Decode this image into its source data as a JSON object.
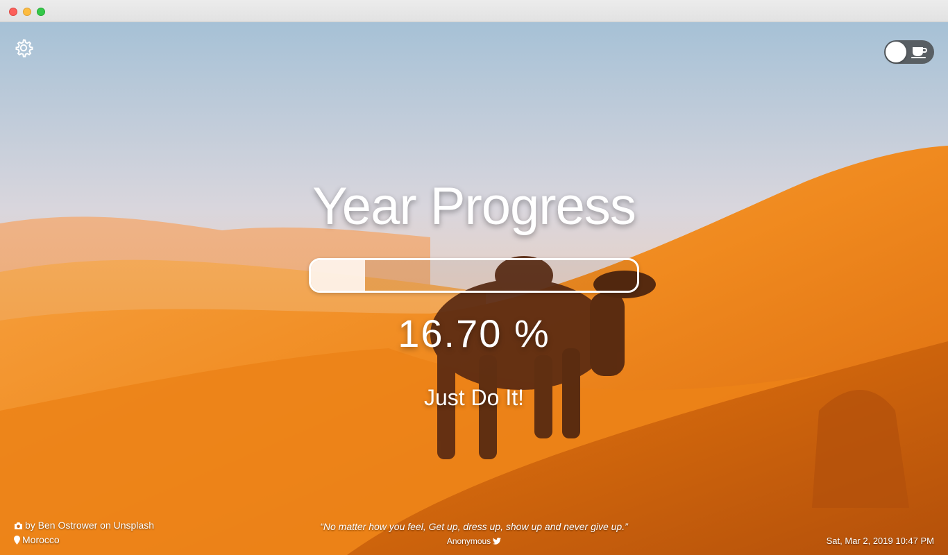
{
  "app": {
    "title": "Year Progress",
    "percent_text": "16.70 %",
    "progress_fraction": 0.167,
    "motto": "Just Do It!"
  },
  "photo_credit": {
    "author_text": "by Ben Ostrower on Unsplash",
    "location": "Morocco"
  },
  "quote": {
    "text": "“No matter how you feel, Get up, dress up, show up and never give up.”",
    "author": "Anonymous"
  },
  "datetime": "Sat, Mar 2, 2019 10:47 PM",
  "toolbar": {
    "settings_icon": "gear-icon",
    "mode_toggle_icon": "coffee-cup-icon",
    "toggle_state": "off"
  },
  "colors": {
    "sky_top": "#a9c3d8",
    "sand_orange": "#f08a1e",
    "text": "#ffffff"
  }
}
